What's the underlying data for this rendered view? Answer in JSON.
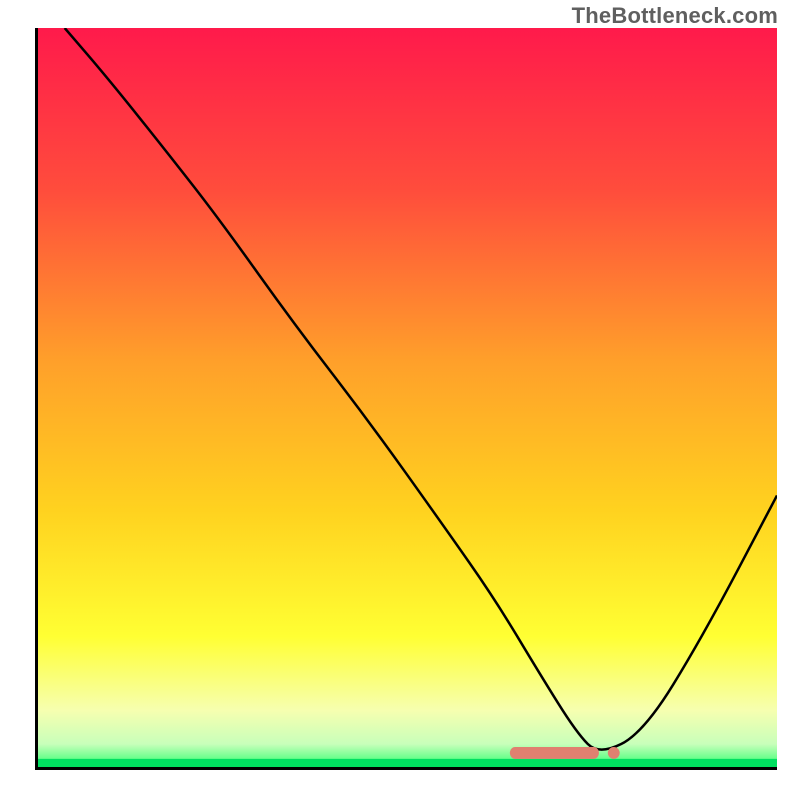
{
  "watermark": {
    "text": "TheBottleneck.com"
  },
  "chart_data": {
    "type": "line",
    "title": "",
    "xlabel": "",
    "ylabel": "",
    "xlim": [
      0,
      100
    ],
    "ylim": [
      0,
      100
    ],
    "grid": false,
    "legend": false,
    "background": {
      "kind": "vertical-gradient",
      "stops": [
        {
          "pos": 0.0,
          "color": "#ff1a4b"
        },
        {
          "pos": 0.22,
          "color": "#ff4d3c"
        },
        {
          "pos": 0.45,
          "color": "#ffa02a"
        },
        {
          "pos": 0.65,
          "color": "#ffd21f"
        },
        {
          "pos": 0.82,
          "color": "#ffff33"
        },
        {
          "pos": 0.92,
          "color": "#f6ffb0"
        },
        {
          "pos": 0.965,
          "color": "#c8ffba"
        },
        {
          "pos": 0.985,
          "color": "#66ff8a"
        },
        {
          "pos": 1.0,
          "color": "#00e060"
        }
      ]
    },
    "series": [
      {
        "name": "bottleneck-curve",
        "color": "#000000",
        "x": [
          4,
          10,
          18,
          25,
          35,
          45,
          55,
          62,
          68,
          73,
          76,
          82,
          90,
          100
        ],
        "y": [
          100,
          93,
          83,
          74,
          60,
          47,
          33,
          23,
          13,
          5,
          2,
          5,
          18,
          37
        ]
      }
    ],
    "highlight_marker": {
      "name": "optimal-range",
      "shape": "rounded-strip",
      "color": "#e08070",
      "x_range": [
        64,
        76
      ],
      "y": 2.3,
      "dot_x": 78
    }
  }
}
